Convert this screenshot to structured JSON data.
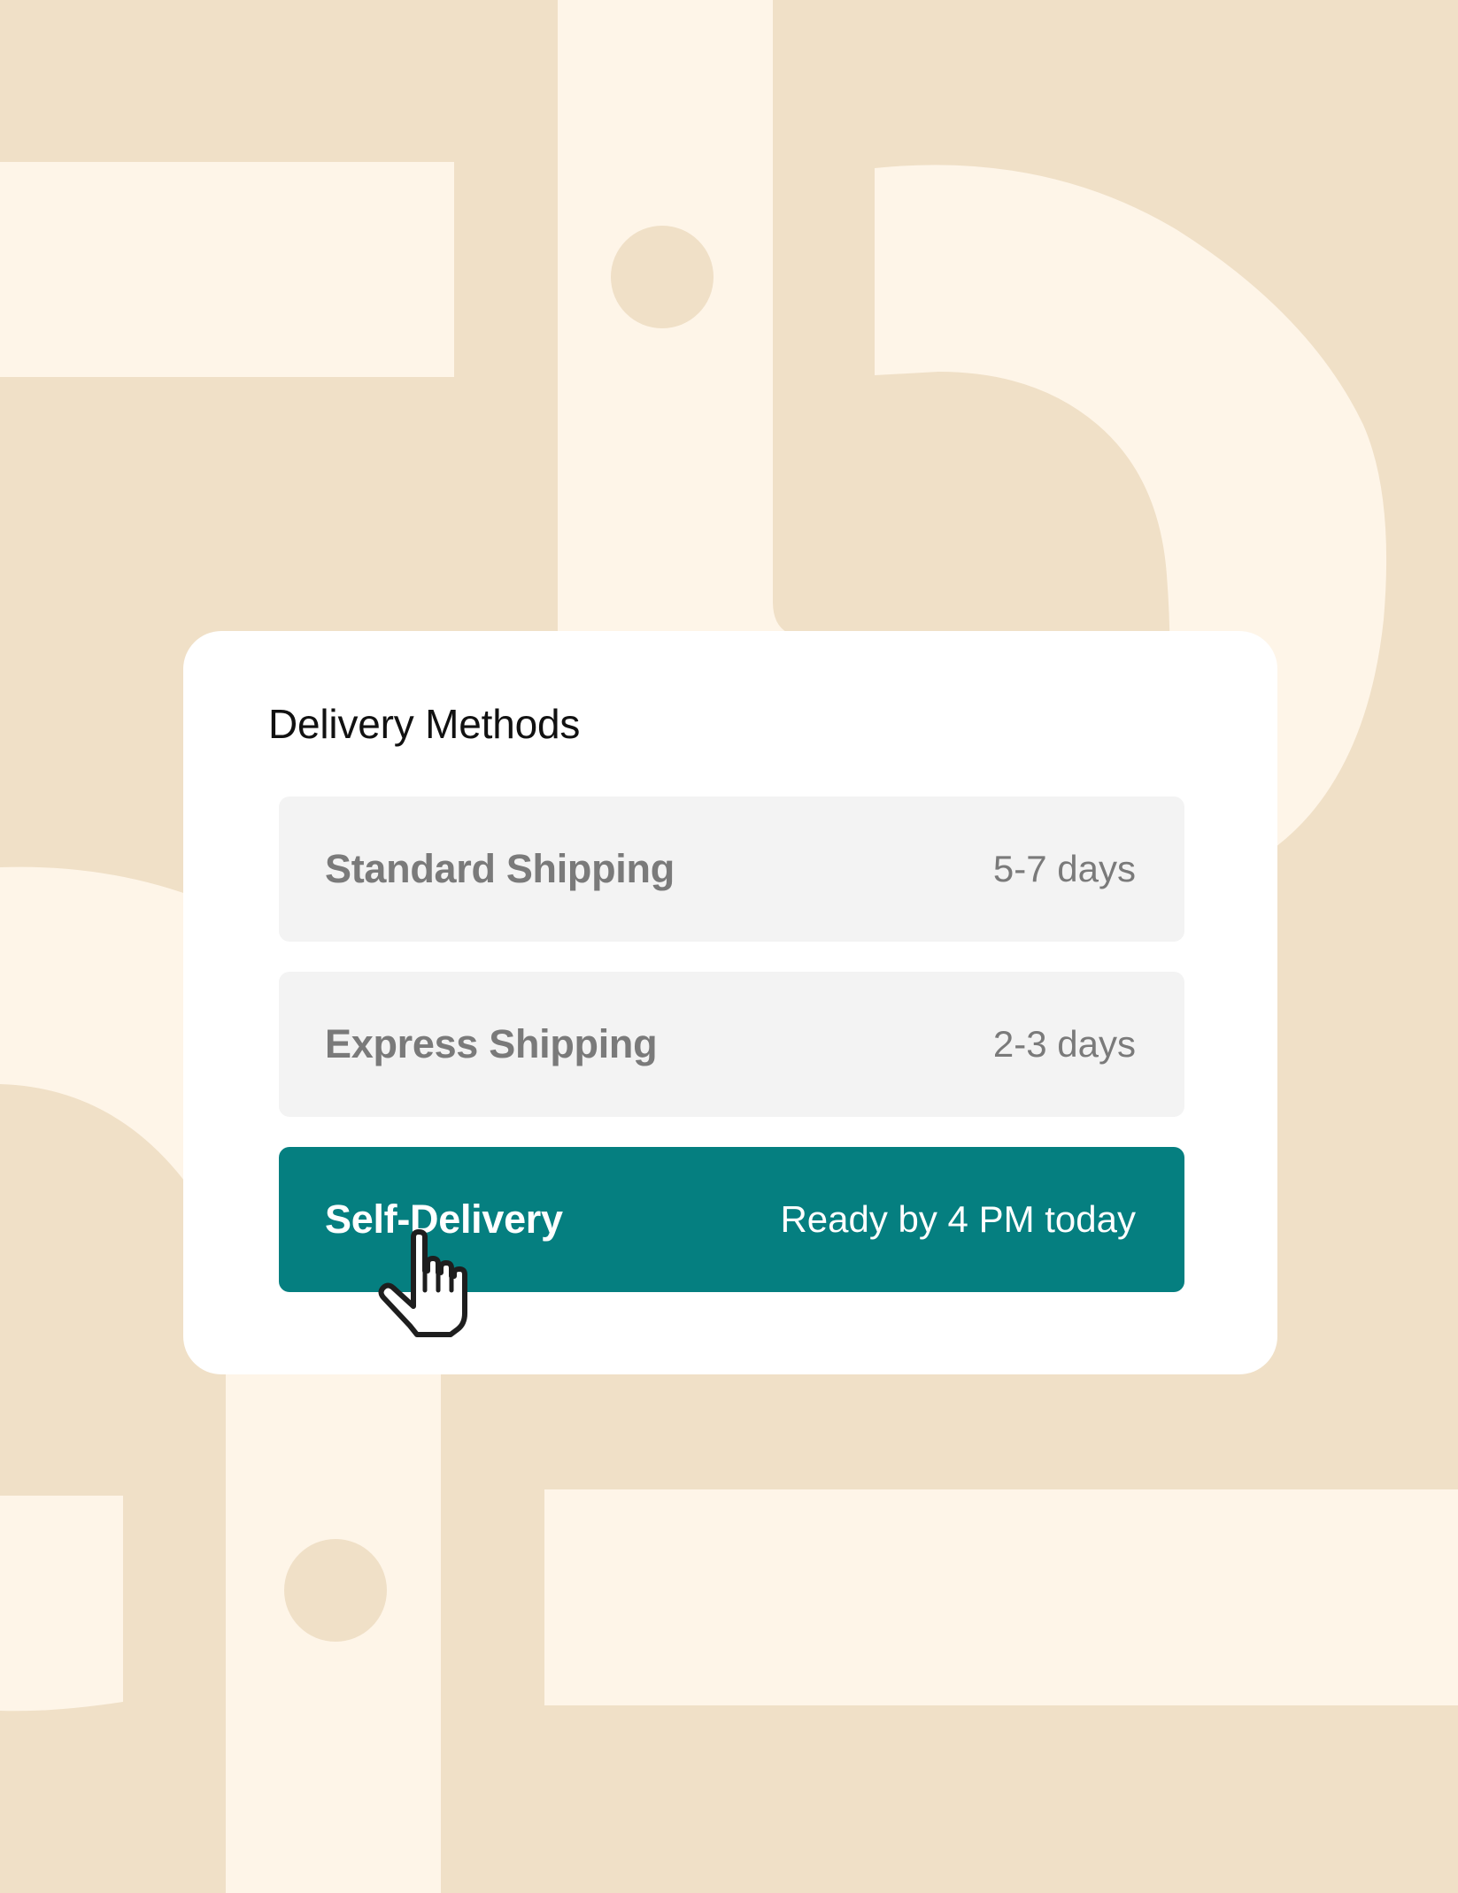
{
  "colors": {
    "background": "#f0e0c7",
    "background_shapes": "#fef5e8",
    "card": "#ffffff",
    "option_default": "#f3f3f3",
    "option_selected": "#057f80",
    "option_text_default": "#7a7a7a",
    "option_text_selected": "#ffffff"
  },
  "panel": {
    "title": "Delivery Methods",
    "options": [
      {
        "name": "Standard Shipping",
        "eta": "5-7 days",
        "selected": false
      },
      {
        "name": "Express Shipping",
        "eta": "2-3 days",
        "selected": false
      },
      {
        "name": "Self-Delivery",
        "eta": "Ready by 4 PM today",
        "selected": true
      }
    ]
  },
  "cursor": {
    "icon": "hand-pointer-icon"
  }
}
